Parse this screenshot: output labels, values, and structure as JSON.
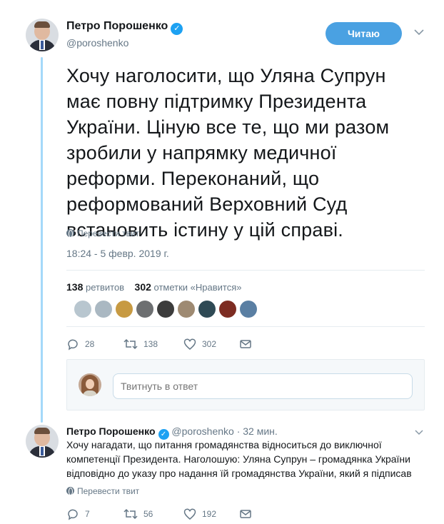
{
  "main_tweet": {
    "author_name": "Петро Порошенко",
    "author_handle": "@poroshenko",
    "follow_label": "Читаю",
    "text": "Хочу наголосити, що Уляна Супрун має повну підтримку Президента України. Ціную все те, що ми разом зробили у напрямку медичної реформи. Переконаний, що реформований Верховний Суд встановить істину у цій справі.",
    "translate_label": "Перевести твит",
    "timestamp": "18:24 - 5 февр. 2019 г.",
    "retweets_count": "138",
    "retweets_label": "ретвитов",
    "likes_count": "302",
    "likes_label": "отметки «Нравится»",
    "actions": {
      "reply_count": "28",
      "retweet_count": "138",
      "like_count": "302"
    }
  },
  "reply_box": {
    "placeholder": "Твитнуть в ответ"
  },
  "reply_tweet": {
    "author_name": "Петро Порошенко",
    "author_handle": "@poroshenko",
    "time": "· 32 мин.",
    "text": "Хочу нагадати, що питання громадянства відноситься до виключної компетенції Президента. Наголошую: Уляна Супрун – громадянка України відповідно до указу про надання їй громадянства України, який я підписав",
    "translate_label": "Перевести твит",
    "actions": {
      "reply_count": "7",
      "retweet_count": "56",
      "like_count": "192"
    }
  },
  "likers": [
    {
      "icon": "liker-avatar",
      "color": "#b8c6cf"
    },
    {
      "icon": "default-avatar",
      "color": "#aab8c2"
    },
    {
      "icon": "liker-avatar",
      "color": "#c79a42"
    },
    {
      "icon": "liker-avatar",
      "color": "#6d6f71"
    },
    {
      "icon": "liker-avatar",
      "color": "#3c3c3c"
    },
    {
      "icon": "liker-avatar",
      "color": "#9e8a72"
    },
    {
      "icon": "liker-avatar",
      "color": "#2f4a55"
    },
    {
      "icon": "liker-avatar",
      "color": "#7d2c22"
    },
    {
      "icon": "liker-avatar",
      "color": "#5a7fa3"
    }
  ],
  "colors": {
    "accent": "#1da1f2",
    "follow_button": "#4aa1e2",
    "thread_line": "#a4d9f9",
    "muted_text": "#657786"
  }
}
